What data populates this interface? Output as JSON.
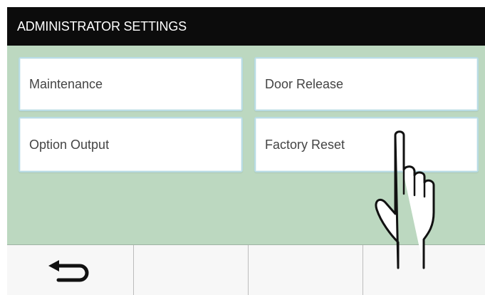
{
  "header": {
    "title": "ADMINISTRATOR SETTINGS"
  },
  "menu": {
    "maintenance": "Maintenance",
    "door_release": "Door Release",
    "option_output": "Option Output",
    "factory_reset": "Factory Reset"
  },
  "bottom_bar": {
    "keys": [
      {
        "icon": "back-arrow-icon"
      },
      {
        "icon": ""
      },
      {
        "icon": ""
      },
      {
        "icon": ""
      }
    ]
  },
  "colors": {
    "title_bar": "#0c0c0c",
    "content_bg": "#bcd8c0",
    "button_border": "#b8dce4"
  },
  "overlay": {
    "icon": "pointing-hand-icon"
  }
}
